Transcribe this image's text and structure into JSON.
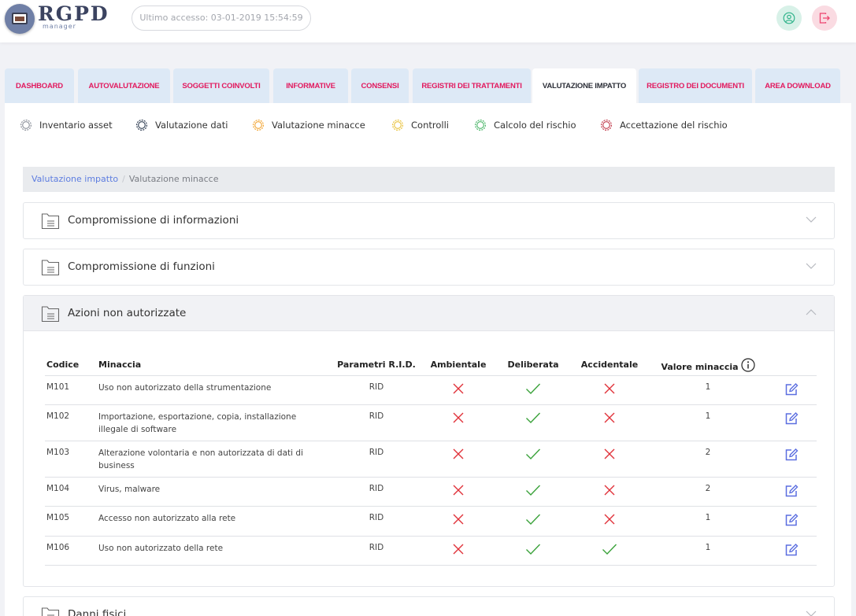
{
  "header": {
    "logo_text": "RGPD",
    "logo_sub": "manager",
    "last_access": "Ultimo accesso: 03-01-2019 15:54:59",
    "icons": [
      "user-icon",
      "logout-icon"
    ],
    "colors": {
      "user_bg": "#d8f1e8",
      "user_fg": "#2fb38a",
      "logout_bg": "#fadbe2",
      "logout_fg": "#ee4570"
    }
  },
  "tabs": [
    {
      "label": "DASHBOARD",
      "active": false
    },
    {
      "label": "AUTOVALUTAZIONE",
      "active": false
    },
    {
      "label": "SOGGETTI COINVOLTI",
      "active": false
    },
    {
      "label": "INFORMATIVE",
      "active": false
    },
    {
      "label": "CONSENSI",
      "active": false
    },
    {
      "label": "REGISTRI DEI TRATTAMENTI",
      "active": false
    },
    {
      "label": "VALUTAZIONE IMPATTO",
      "active": true
    },
    {
      "label": "REGISTRO DEI DOCUMENTI",
      "active": false
    },
    {
      "label": "AREA DOWNLOAD",
      "active": false
    }
  ],
  "subnav": [
    {
      "label": "Inventario asset",
      "icon": "gear-icon",
      "color": "#8a8f99"
    },
    {
      "label": "Valutazione dati",
      "icon": "gear-icon",
      "color": "#2f3d52"
    },
    {
      "label": "Valutazione minacce",
      "icon": "gear-icon",
      "color": "#f2a431"
    },
    {
      "label": "Controlli",
      "icon": "gear-icon",
      "color": "#e9c23a"
    },
    {
      "label": "Calcolo del rischio",
      "icon": "gear-icon",
      "color": "#49b567"
    },
    {
      "label": "Accettazione del rischio",
      "icon": "gear-icon",
      "color": "#c0394a"
    }
  ],
  "breadcrumb": {
    "link": "Valutazione impatto",
    "current": "Valutazione minacce"
  },
  "accordions": [
    {
      "title": "Compromissione di informazioni",
      "open": false
    },
    {
      "title": "Compromissione di funzioni",
      "open": false
    },
    {
      "title": "Azioni non autorizzate",
      "open": true
    },
    {
      "title": "Danni fisici",
      "open": false
    }
  ],
  "table": {
    "headers": {
      "codice": "Codice",
      "minaccia": "Minaccia",
      "rid": "Parametri R.I.D.",
      "ambientale": "Ambientale",
      "deliberata": "Deliberata",
      "accidentale": "Accidentale",
      "valore": "Valore minaccia"
    },
    "rows": [
      {
        "codice": "M101",
        "minaccia": "Uso non autorizzato della strumentazione",
        "rid": "RID",
        "ambientale": false,
        "deliberata": true,
        "accidentale": false,
        "valore": "1"
      },
      {
        "codice": "M102",
        "minaccia": "Importazione, esportazione, copia, installazione illegale di software",
        "rid": "RID",
        "ambientale": false,
        "deliberata": true,
        "accidentale": false,
        "valore": "1"
      },
      {
        "codice": "M103",
        "minaccia": "Alterazione volontaria e non autorizzata di dati di business",
        "rid": "RID",
        "ambientale": false,
        "deliberata": true,
        "accidentale": false,
        "valore": "2"
      },
      {
        "codice": "M104",
        "minaccia": "Virus, malware",
        "rid": "RID",
        "ambientale": false,
        "deliberata": true,
        "accidentale": false,
        "valore": "2"
      },
      {
        "codice": "M105",
        "minaccia": "Accesso non autorizzato alla rete",
        "rid": "RID",
        "ambientale": false,
        "deliberata": true,
        "accidentale": false,
        "valore": "1"
      },
      {
        "codice": "M106",
        "minaccia": "Uso non autorizzato della rete",
        "rid": "RID",
        "ambientale": false,
        "deliberata": true,
        "accidentale": true,
        "valore": "1"
      }
    ]
  },
  "colors": {
    "accent": "#e2195e",
    "check": "#3aa23a",
    "cross": "#e0323a",
    "edit": "#5b6ee0",
    "link": "#5d7de0"
  }
}
